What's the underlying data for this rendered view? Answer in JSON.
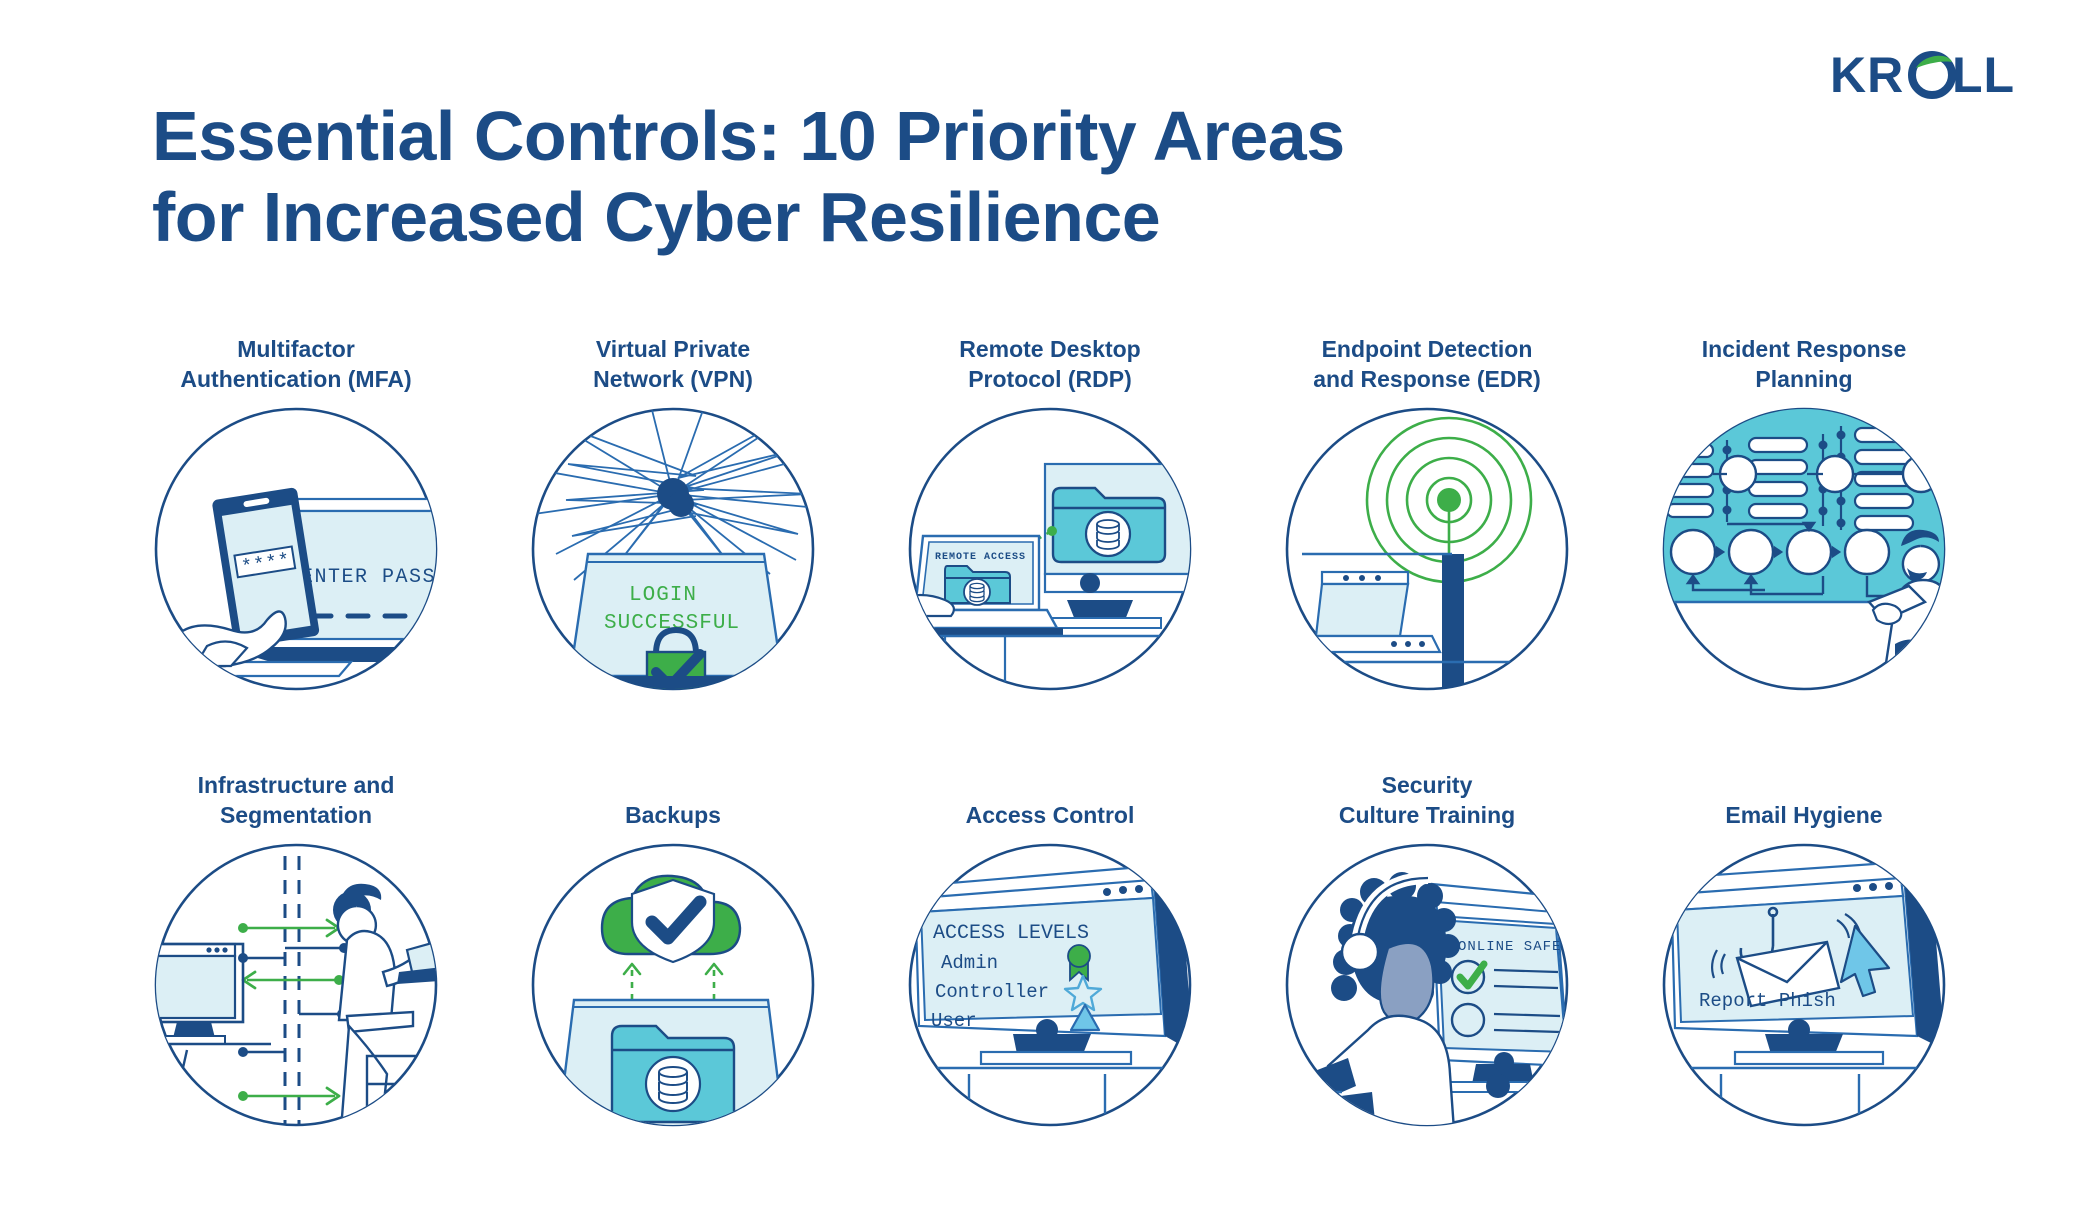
{
  "brand": {
    "logo_text": "KROLL",
    "navy": "#1C4C86",
    "green": "#3DAE49",
    "teal": "#5BC8D8",
    "light_blue": "#DCEFF5",
    "mid_blue": "#2A6CB0"
  },
  "title": {
    "line1": "Essential Controls: 10 Priority Areas",
    "line2": "for Increased Cyber Resilience"
  },
  "cards": [
    {
      "id": "mfa",
      "label": "Multifactor\nAuthentication (MFA)",
      "illustration": "phone-and-laptop-password",
      "texts": {
        "screen_prompt": "ENTER PASSWORD",
        "phone_code": "****",
        "masked_dashes": "— — — —"
      }
    },
    {
      "id": "vpn",
      "label": "Virtual Private\nNetwork (VPN)",
      "illustration": "tunnel-and-laptop-login",
      "texts": {
        "line1": "LOGIN",
        "line2": "SUCCESSFUL"
      }
    },
    {
      "id": "rdp",
      "label": "Remote Desktop\nProtocol (RDP)",
      "illustration": "laptop-to-desktop-folder",
      "texts": {
        "screen_label": "REMOTE ACCESS"
      }
    },
    {
      "id": "edr",
      "label": "Endpoint Detection\nand Response (EDR)",
      "illustration": "laptop-with-signal-waves",
      "texts": {}
    },
    {
      "id": "irp",
      "label": "Incident Response\nPlanning",
      "illustration": "flowchart-with-person-tablet",
      "texts": {}
    },
    {
      "id": "infra",
      "label": "Infrastructure and\nSegmentation",
      "illustration": "segmentation-barrier-arrows",
      "texts": {}
    },
    {
      "id": "backups",
      "label": "Backups",
      "illustration": "cloud-shield-folder-upload",
      "texts": {}
    },
    {
      "id": "access",
      "label": "Access Control",
      "illustration": "monitor-access-levels-list",
      "texts": {
        "heading": "ACCESS LEVELS",
        "rows": [
          "Admin",
          "Controller",
          "User"
        ],
        "row_icons": [
          "badge-icon",
          "star-icon",
          "triangle-icon"
        ]
      }
    },
    {
      "id": "training",
      "label": "Security\nCulture Training",
      "illustration": "person-headphones-checklist",
      "texts": {
        "heading": "ONLINE SAFETY"
      }
    },
    {
      "id": "email",
      "label": "Email Hygiene",
      "illustration": "monitor-phish-envelope-cursor",
      "texts": {
        "button_label": "Report Phish"
      }
    }
  ]
}
